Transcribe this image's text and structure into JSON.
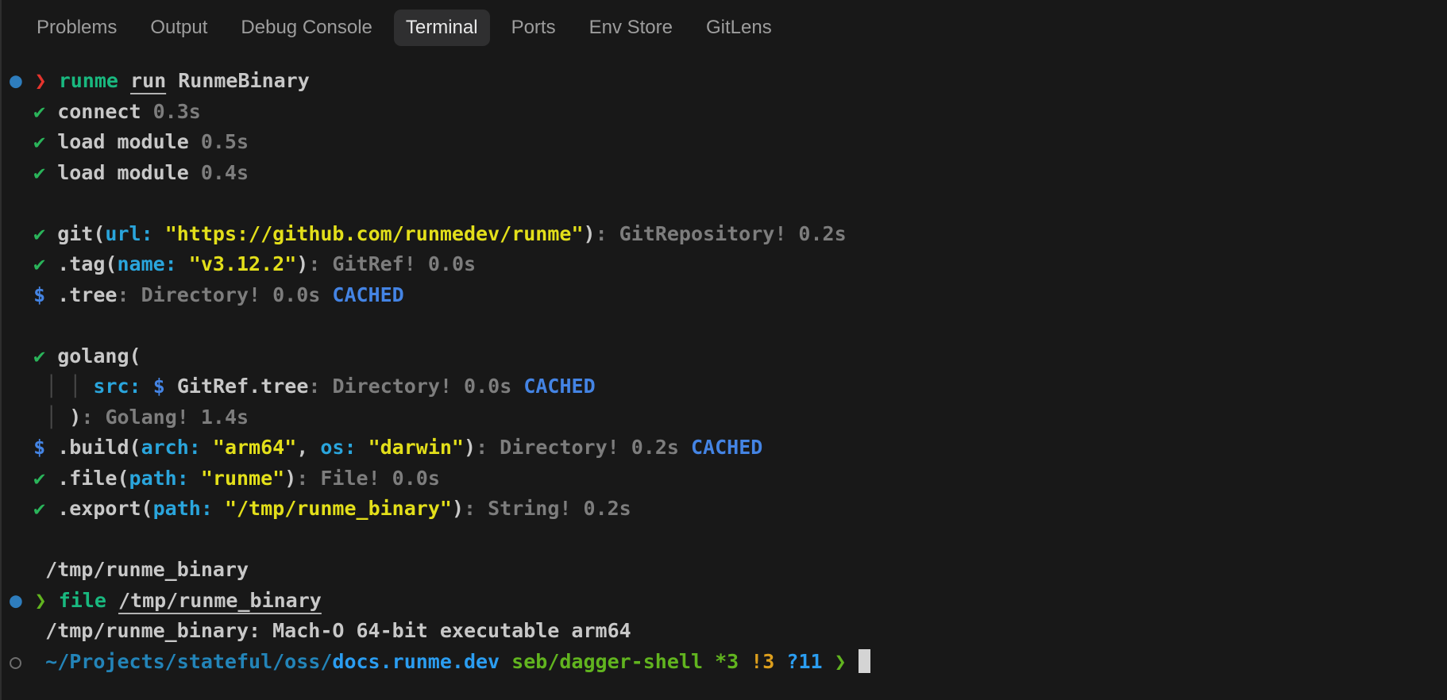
{
  "panel_tabs": {
    "items": [
      {
        "label": "Problems",
        "active": false
      },
      {
        "label": "Output",
        "active": false
      },
      {
        "label": "Debug Console",
        "active": false
      },
      {
        "label": "Terminal",
        "active": true
      },
      {
        "label": "Ports",
        "active": false
      },
      {
        "label": "Env Store",
        "active": false
      },
      {
        "label": "GitLens",
        "active": false
      }
    ]
  },
  "terminal": {
    "lines": [
      {
        "segments": [
          {
            "text": "●",
            "style": "dot",
            "block2": true,
            "name": "run-status-dot-icon"
          },
          {
            "text": "❯",
            "style": "red",
            "block2": true,
            "name": "prompt-chevron-icon"
          },
          {
            "text": "runme",
            "style": "cmd",
            "name": "command-name"
          },
          {
            "text": " "
          },
          {
            "text": "run",
            "style": "default",
            "underline": true,
            "name": "run-subcommand-link",
            "interactable": true
          },
          {
            "text": " RunmeBinary",
            "style": "default",
            "name": "command-argument"
          }
        ]
      },
      {
        "segments": [
          {
            "text": "  "
          },
          {
            "text": "✔",
            "style": "check",
            "block2": true,
            "name": "check-icon"
          },
          {
            "text": "connect ",
            "style": "default"
          },
          {
            "text": "0.3s",
            "style": "dim",
            "name": "duration"
          }
        ]
      },
      {
        "segments": [
          {
            "text": "  "
          },
          {
            "text": "✔",
            "style": "check",
            "block2": true,
            "name": "check-icon"
          },
          {
            "text": "load module ",
            "style": "default"
          },
          {
            "text": "0.5s",
            "style": "dim",
            "name": "duration"
          }
        ]
      },
      {
        "segments": [
          {
            "text": "  "
          },
          {
            "text": "✔",
            "style": "check",
            "block2": true,
            "name": "check-icon"
          },
          {
            "text": "load module ",
            "style": "default"
          },
          {
            "text": "0.4s",
            "style": "dim",
            "name": "duration"
          }
        ]
      },
      {
        "segments": [
          {
            "text": ""
          }
        ]
      },
      {
        "segments": [
          {
            "text": "  "
          },
          {
            "text": "✔",
            "style": "check",
            "block2": true,
            "name": "check-icon"
          },
          {
            "text": "git(",
            "style": "default"
          },
          {
            "text": "url:",
            "style": "cyan",
            "name": "param-name"
          },
          {
            "text": " "
          },
          {
            "text": "\"https://github.com/runmedev/runme\"",
            "style": "yellow",
            "name": "string-value"
          },
          {
            "text": ")",
            "style": "default"
          },
          {
            "text": ": GitRepository! 0.2s",
            "style": "dim",
            "name": "result-type"
          }
        ]
      },
      {
        "segments": [
          {
            "text": "  "
          },
          {
            "text": "✔",
            "style": "check",
            "block2": true,
            "name": "check-icon"
          },
          {
            "text": ".tag(",
            "style": "default"
          },
          {
            "text": "name:",
            "style": "cyan",
            "name": "param-name"
          },
          {
            "text": " "
          },
          {
            "text": "\"v3.12.2\"",
            "style": "yellow",
            "name": "string-value"
          },
          {
            "text": ")",
            "style": "default"
          },
          {
            "text": ": GitRef! 0.0s",
            "style": "dim",
            "name": "result-type"
          }
        ]
      },
      {
        "segments": [
          {
            "text": "  "
          },
          {
            "text": "$",
            "style": "blue",
            "block2": true,
            "name": "dollar-icon"
          },
          {
            "text": ".tree",
            "style": "default"
          },
          {
            "text": ": Directory! 0.0s ",
            "style": "dim",
            "name": "result-type"
          },
          {
            "text": "CACHED",
            "style": "blue",
            "name": "cached-badge"
          }
        ]
      },
      {
        "segments": [
          {
            "text": ""
          }
        ]
      },
      {
        "segments": [
          {
            "text": "  "
          },
          {
            "text": "✔",
            "style": "check",
            "block2": true,
            "name": "check-icon"
          },
          {
            "text": "golang(",
            "style": "default"
          }
        ]
      },
      {
        "segments": [
          {
            "text": "   "
          },
          {
            "text": "│",
            "style": "guide",
            "name": "tree-guide-icon"
          },
          {
            "text": " "
          },
          {
            "text": "│",
            "style": "guide",
            "name": "tree-guide-icon"
          },
          {
            "text": " "
          },
          {
            "text": "src:",
            "style": "cyan",
            "name": "param-name"
          },
          {
            "text": " "
          },
          {
            "text": "$",
            "style": "blue",
            "name": "dollar-icon"
          },
          {
            "text": " "
          },
          {
            "text": "GitRef.tree",
            "style": "default"
          },
          {
            "text": ": Directory! 0.0s ",
            "style": "dim",
            "name": "result-type"
          },
          {
            "text": "CACHED",
            "style": "blue",
            "name": "cached-badge"
          }
        ]
      },
      {
        "segments": [
          {
            "text": "   "
          },
          {
            "text": "│",
            "style": "guide",
            "name": "tree-guide-icon"
          },
          {
            "text": " "
          },
          {
            "text": ")",
            "style": "default"
          },
          {
            "text": ": Golang! 1.4s",
            "style": "dim",
            "name": "result-type"
          }
        ]
      },
      {
        "segments": [
          {
            "text": "  "
          },
          {
            "text": "$",
            "style": "blue",
            "block2": true,
            "name": "dollar-icon"
          },
          {
            "text": ".build(",
            "style": "default"
          },
          {
            "text": "arch:",
            "style": "cyan",
            "name": "param-name"
          },
          {
            "text": " "
          },
          {
            "text": "\"arm64\"",
            "style": "yellow",
            "name": "string-value"
          },
          {
            "text": ", ",
            "style": "default"
          },
          {
            "text": "os:",
            "style": "cyan",
            "name": "param-name"
          },
          {
            "text": " "
          },
          {
            "text": "\"darwin\"",
            "style": "yellow",
            "name": "string-value"
          },
          {
            "text": ")",
            "style": "default"
          },
          {
            "text": ": Directory! 0.2s ",
            "style": "dim",
            "name": "result-type"
          },
          {
            "text": "CACHED",
            "style": "blue",
            "name": "cached-badge"
          }
        ]
      },
      {
        "segments": [
          {
            "text": "  "
          },
          {
            "text": "✔",
            "style": "check",
            "block2": true,
            "name": "check-icon"
          },
          {
            "text": ".file(",
            "style": "default"
          },
          {
            "text": "path:",
            "style": "cyan",
            "name": "param-name"
          },
          {
            "text": " "
          },
          {
            "text": "\"runme\"",
            "style": "yellow",
            "name": "string-value"
          },
          {
            "text": ")",
            "style": "default"
          },
          {
            "text": ": File! 0.0s",
            "style": "dim",
            "name": "result-type"
          }
        ]
      },
      {
        "segments": [
          {
            "text": "  "
          },
          {
            "text": "✔",
            "style": "check",
            "block2": true,
            "name": "check-icon"
          },
          {
            "text": ".export(",
            "style": "default"
          },
          {
            "text": "path:",
            "style": "cyan",
            "name": "param-name"
          },
          {
            "text": " "
          },
          {
            "text": "\"/tmp/runme_binary\"",
            "style": "yellow",
            "name": "string-value"
          },
          {
            "text": ")",
            "style": "default"
          },
          {
            "text": ": String! 0.2s",
            "style": "dim",
            "name": "result-type"
          }
        ]
      },
      {
        "segments": [
          {
            "text": ""
          }
        ]
      },
      {
        "segments": [
          {
            "text": "   "
          },
          {
            "text": "/tmp/runme_binary",
            "style": "default",
            "name": "output-path"
          }
        ]
      },
      {
        "segments": [
          {
            "text": "●",
            "style": "dot",
            "block2": true,
            "name": "run-status-dot-icon"
          },
          {
            "text": "❯",
            "style": "lime",
            "block2": true,
            "name": "prompt-chevron-icon"
          },
          {
            "text": "file",
            "style": "cmd",
            "name": "command-name"
          },
          {
            "text": " "
          },
          {
            "text": "/tmp/runme_binary",
            "style": "default",
            "underline": true,
            "name": "file-path-link",
            "interactable": true
          }
        ]
      },
      {
        "segments": [
          {
            "text": "   "
          },
          {
            "text": "/tmp/runme_binary: Mach-O 64-bit executable arm64",
            "style": "default",
            "name": "file-command-output"
          }
        ]
      },
      {
        "segments": [
          {
            "text": "○",
            "style": "ring",
            "block2": true,
            "name": "prompt-ring-icon"
          },
          {
            "text": " "
          },
          {
            "text": "~/Projects/stateful/oss/",
            "style": "teal",
            "name": "cwd-path"
          },
          {
            "text": "docs.runme.dev",
            "style": "brightblue",
            "bold": true,
            "name": "cwd-basename"
          },
          {
            "text": " "
          },
          {
            "text": "seb/dagger-shell",
            "style": "lime",
            "name": "git-branch"
          },
          {
            "text": " "
          },
          {
            "text": "*3",
            "style": "lime",
            "name": "git-modified-count"
          },
          {
            "text": " "
          },
          {
            "text": "!3",
            "style": "amber",
            "name": "git-unstaged-count"
          },
          {
            "text": " "
          },
          {
            "text": "?11",
            "style": "brightblue",
            "name": "git-untracked-count"
          },
          {
            "text": " "
          },
          {
            "text": "❯",
            "style": "lime",
            "name": "prompt-chevron-icon"
          },
          {
            "text": " "
          },
          {
            "cursor": true,
            "name": "terminal-cursor",
            "interactable": true
          }
        ]
      }
    ]
  },
  "colors": {
    "background": "#181818",
    "panel_border": "#2e2e2e",
    "tab_inactive": "#9d9d9d",
    "tab_active": "#e8e8e8",
    "tab_active_bg": "#2f2f30",
    "foreground": "#c8c8c8",
    "dim": "#7d7d7d",
    "check_green": "#2ab45a",
    "command_green": "#19b87f",
    "chevron_red": "#e5342d",
    "dot_blue": "#2e7dbd",
    "param_cyan": "#2aa5dc",
    "string_yellow": "#e3df1a",
    "accent_blue": "#4484e4",
    "path_teal": "#2384b8",
    "bright_blue": "#2b9df0",
    "branch_lime": "#61b41f",
    "amber": "#dd9f1d",
    "guide_gray": "#4a4a4a",
    "ring_gray": "#6e6e6e",
    "cursor": "#d4d4d4"
  }
}
